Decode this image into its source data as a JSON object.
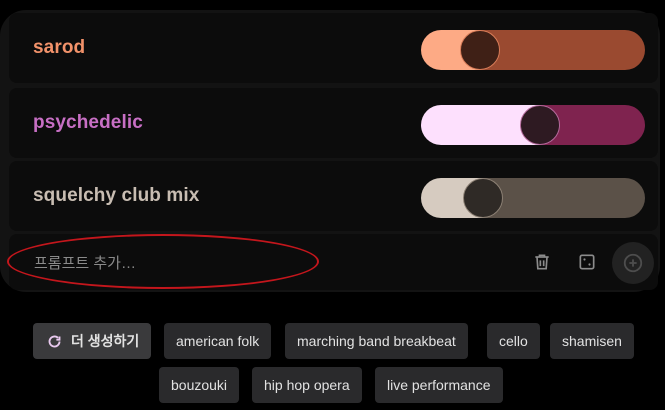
{
  "prompts": [
    {
      "label": "sarod",
      "label_color": "#f2926a",
      "fill_color": "#fdaa85",
      "track_color": "#9a4a30",
      "knob_color": "#3f2016",
      "knob_border": "#d87c58",
      "weight": 0.21
    },
    {
      "label": "psychedelic",
      "label_color": "#c76fc4",
      "fill_color": "#fde0fd",
      "track_color": "#7f234f",
      "knob_color": "#2e1a22",
      "knob_border": "#b46a9c",
      "weight": 0.54
    },
    {
      "label": "squelchy club mix",
      "label_color": "#c8bdb2",
      "fill_color": "#d6cbc0",
      "track_color": "#5b5148",
      "knob_color": "#2f2a26",
      "knob_border": "#8c8074",
      "weight": 0.23
    }
  ],
  "input": {
    "placeholder": "프롬프트 추가…",
    "value": ""
  },
  "toolbar": {
    "delete_icon": "trash-icon",
    "random_icon": "dice-icon",
    "add_icon": "plus-circle-icon"
  },
  "suggestions": {
    "generate_label": "더 생성하기",
    "generate_icon": "refresh-icon",
    "chips": [
      "american folk",
      "marching band breakbeat",
      "cello",
      "shamisen",
      "bouzouki",
      "hip hop opera",
      "live performance"
    ]
  },
  "colors": {
    "background": "#000000",
    "panel": "#131313",
    "row": "#0c0c0c",
    "chip": "#2a2a2c",
    "highlight_ellipse": "#c4161c"
  }
}
